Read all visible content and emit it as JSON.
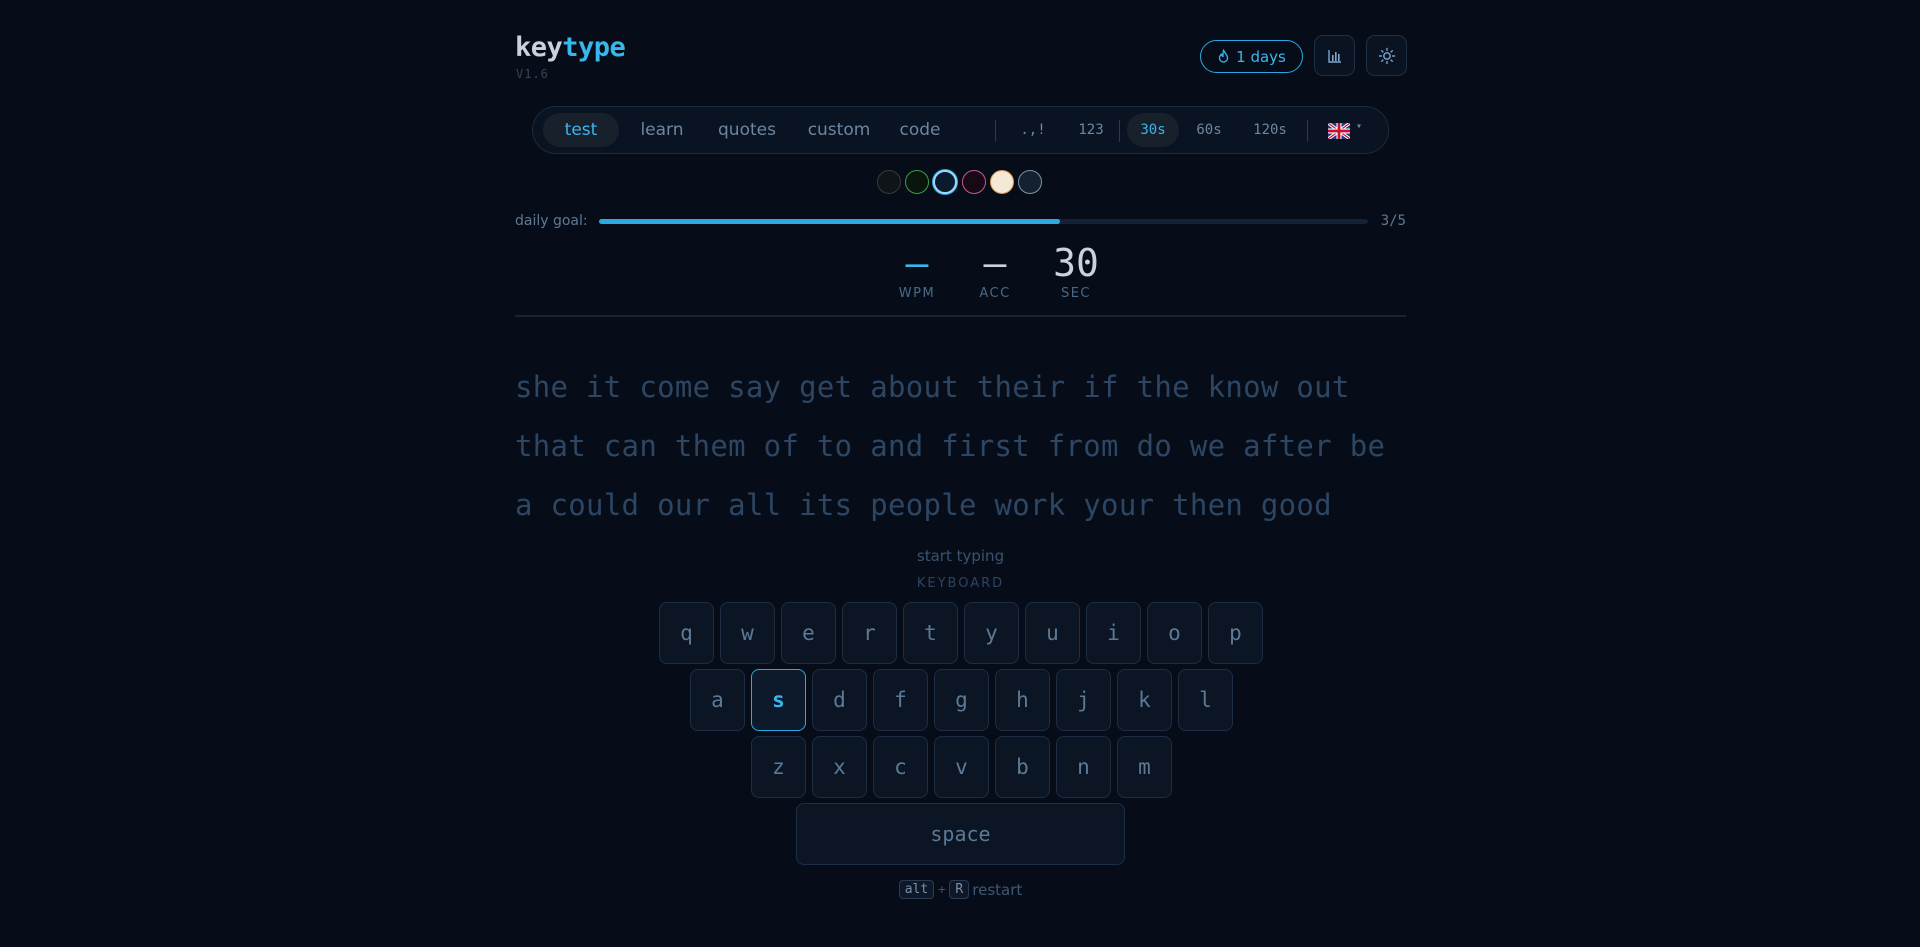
{
  "header": {
    "logo_part1": "key",
    "logo_part2": "type",
    "version": "V1.6",
    "streak_label": "1 days",
    "icons": {
      "streak": "flame-icon",
      "stats": "bar-chart-icon",
      "theme": "sun-icon"
    }
  },
  "modebar": {
    "modes": [
      "test",
      "learn",
      "quotes",
      "custom",
      "code"
    ],
    "active_mode": "test",
    "options": [
      ".,!",
      "123"
    ],
    "durations": [
      "30s",
      "60s",
      "120s"
    ],
    "active_duration": "30s",
    "language_icon": "uk-flag-icon",
    "caret": "▾"
  },
  "themes": {
    "swatches": [
      {
        "fill": "#0f1418",
        "border": "#3a3a34"
      },
      {
        "fill": "#08160e",
        "border": "#3f9a4a"
      },
      {
        "fill": "#0b1a2c",
        "border": "#9fd8ff"
      },
      {
        "fill": "#170a16",
        "border": "#c65a86"
      },
      {
        "fill": "#f5e8d6",
        "border": "#d89a50"
      },
      {
        "fill": "#142130",
        "border": "#7a94ab"
      }
    ],
    "active_index": 2
  },
  "daily_goal": {
    "label": "daily goal:",
    "count": "3/5",
    "progress": 0.6
  },
  "stats": {
    "wpm_value": "—",
    "wpm_label": "WPM",
    "acc_value": "—",
    "acc_label": "ACC",
    "sec_value": "30",
    "sec_label": "SEC"
  },
  "words": {
    "lines": [
      "she it come say get about their if the know out",
      "that can them of to and first from do we after be",
      "a could our all its people work your then good"
    ]
  },
  "hints": {
    "start": "start typing",
    "keyboard": "KEYBOARD"
  },
  "keyboard": {
    "row1": [
      "q",
      "w",
      "e",
      "r",
      "t",
      "y",
      "u",
      "i",
      "o",
      "p"
    ],
    "row2": [
      "a",
      "s",
      "d",
      "f",
      "g",
      "h",
      "j",
      "k",
      "l"
    ],
    "row3": [
      "z",
      "x",
      "c",
      "v",
      "b",
      "n",
      "m"
    ],
    "space": "space",
    "highlighted": "s"
  },
  "restart": {
    "key1": "alt",
    "plus": "+",
    "key2": "R",
    "label": "restart"
  },
  "colors": {
    "accent": "#38b6ee",
    "background": "#070d18"
  }
}
